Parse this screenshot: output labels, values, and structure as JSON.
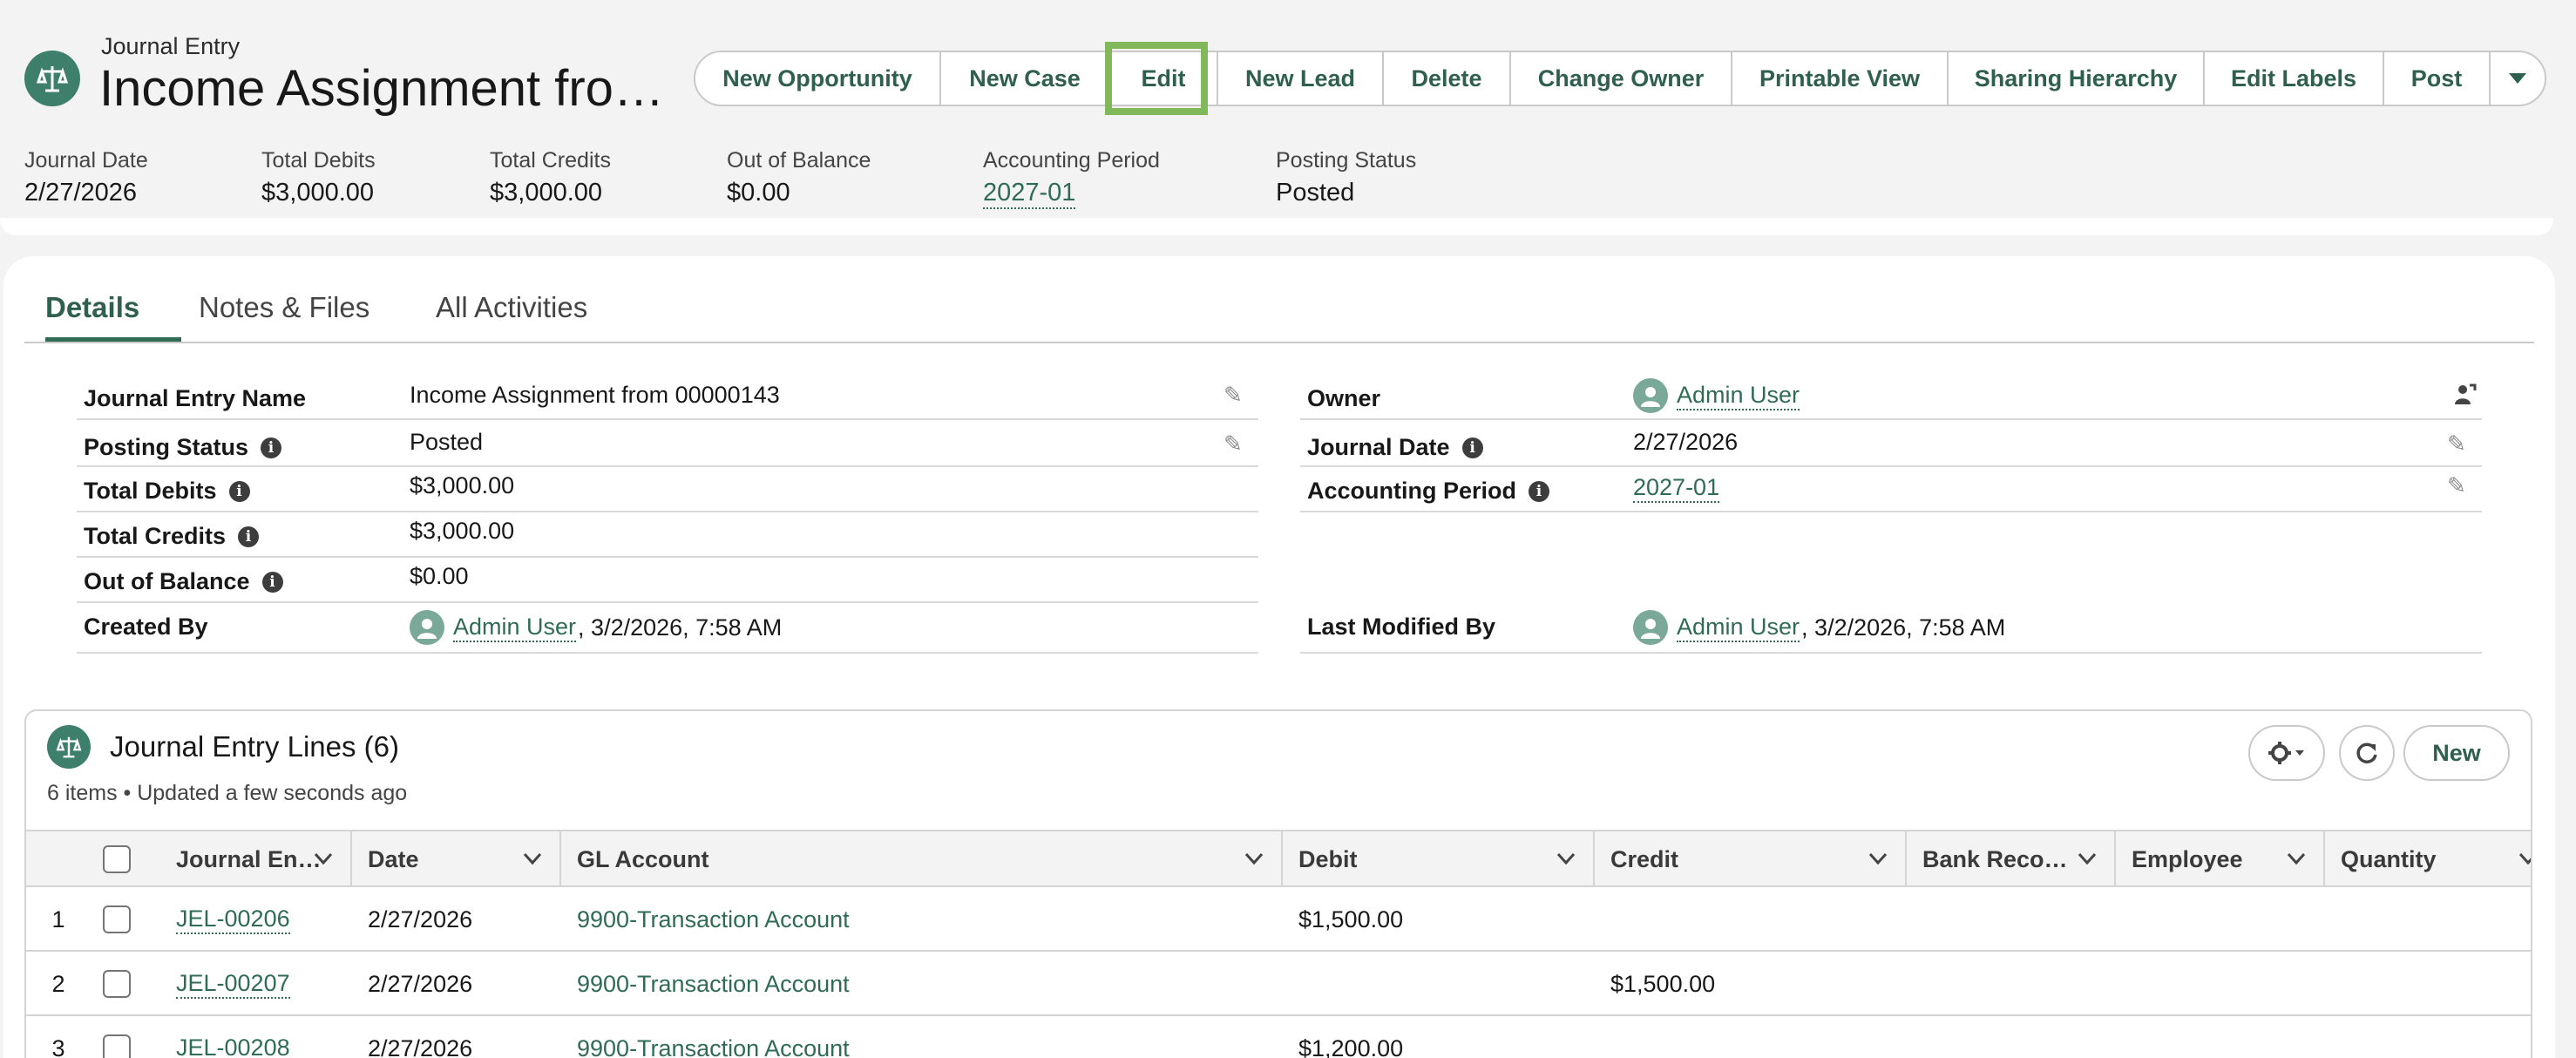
{
  "header": {
    "object_type": "Journal Entry",
    "title": "Income Assignment fro…",
    "buttons": [
      "New Opportunity",
      "New Case",
      "Edit",
      "New Lead",
      "Delete",
      "Change Owner",
      "Printable View",
      "Sharing Hierarchy",
      "Edit Labels",
      "Post"
    ],
    "highlights": [
      {
        "label": "Journal Date",
        "value": "2/27/2026"
      },
      {
        "label": "Total Debits",
        "value": "$3,000.00"
      },
      {
        "label": "Total Credits",
        "value": "$3,000.00"
      },
      {
        "label": "Out of Balance",
        "value": "$0.00"
      },
      {
        "label": "Accounting Period",
        "value": "2027-01"
      },
      {
        "label": "Posting Status",
        "value": "Posted"
      }
    ]
  },
  "tabs": [
    "Details",
    "Notes & Files",
    "All Activities"
  ],
  "details": {
    "left": [
      {
        "label": "Journal Entry Name",
        "value": "Income Assignment from 00000143"
      },
      {
        "label": "Posting Status",
        "value": "Posted"
      },
      {
        "label": "Total Debits",
        "value": "$3,000.00"
      },
      {
        "label": "Total Credits",
        "value": "$3,000.00"
      },
      {
        "label": "Out of Balance",
        "value": "$0.00"
      },
      {
        "label": "Created By",
        "user": "Admin User",
        "value": ", 3/2/2026, 7:58 AM"
      }
    ],
    "right": [
      {
        "label": "Owner",
        "user": "Admin User"
      },
      {
        "label": "Journal Date",
        "value": "2/27/2026"
      },
      {
        "label": "Accounting Period",
        "value": "2027-01"
      },
      {
        "label": "Last Modified By",
        "user": "Admin User",
        "value": ", 3/2/2026, 7:58 AM"
      }
    ]
  },
  "related_list": {
    "title": "Journal Entry Lines (6)",
    "subtitle": "6 items • Updated a few seconds ago",
    "new_label": "New",
    "columns": [
      "Journal En…",
      "Date",
      "GL Account",
      "Debit",
      "Credit",
      "Bank Reco…",
      "Employee",
      "Quantity"
    ],
    "rows": [
      {
        "num": "1",
        "name": "JEL-00206",
        "date": "2/27/2026",
        "gl": "9900-Transaction Account",
        "debit": "$1,500.00",
        "credit": ""
      },
      {
        "num": "2",
        "name": "JEL-00207",
        "date": "2/27/2026",
        "gl": "9900-Transaction Account",
        "debit": "",
        "credit": "$1,500.00"
      },
      {
        "num": "3",
        "name": "JEL-00208",
        "date": "2/27/2026",
        "gl": "9900-Transaction Account",
        "debit": "$1,200.00",
        "credit": ""
      }
    ]
  }
}
